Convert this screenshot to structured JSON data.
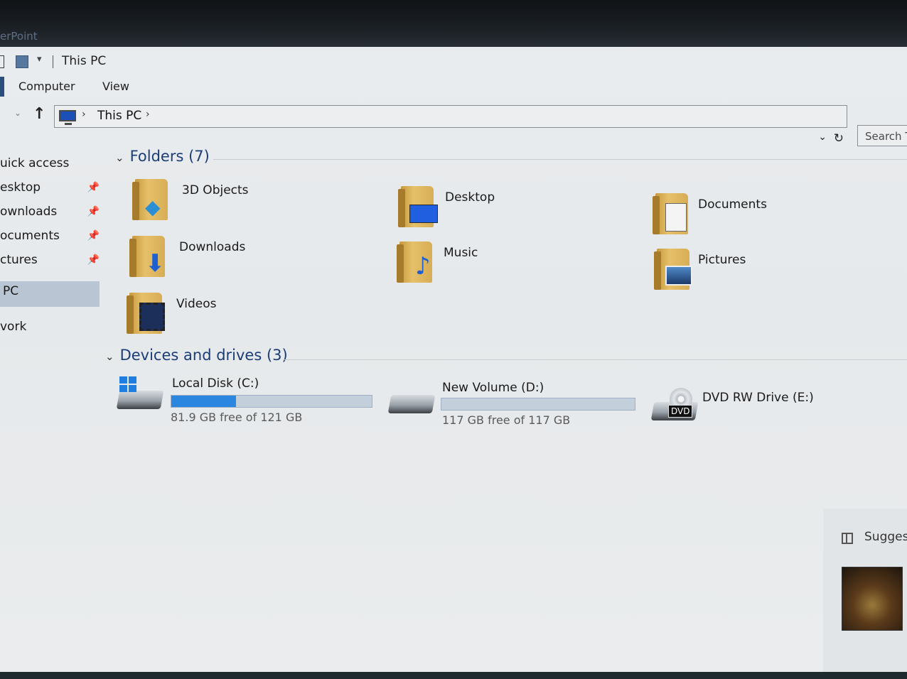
{
  "background_app_label": "erPoint",
  "window": {
    "title": "This PC",
    "qa_dropdown": "▾"
  },
  "ribbon": {
    "tabs": [
      "Computer",
      "View"
    ]
  },
  "address": {
    "path": "This PC",
    "chevron": "›",
    "dropdown": "⌄",
    "refresh": "↻",
    "up": "↑",
    "down": "⌄"
  },
  "search": {
    "placeholder": "Search T"
  },
  "navpane": {
    "items": [
      {
        "label": "uick access",
        "pinned": false
      },
      {
        "label": "esktop",
        "pinned": true
      },
      {
        "label": "ownloads",
        "pinned": true
      },
      {
        "label": "ocuments",
        "pinned": true
      },
      {
        "label": "ctures",
        "pinned": true
      },
      {
        "label": "PC",
        "pinned": false,
        "selected": true
      },
      {
        "label": "vork",
        "pinned": false
      }
    ],
    "pin_glyph": "📌"
  },
  "folders": {
    "header": "Folders (7)",
    "items": [
      {
        "label": "3D Objects",
        "icon": "cube-icon"
      },
      {
        "label": "Desktop",
        "icon": "desktop-icon"
      },
      {
        "label": "Documents",
        "icon": "document-icon"
      },
      {
        "label": "Downloads",
        "icon": "download-arrow-icon"
      },
      {
        "label": "Music",
        "icon": "music-note-icon"
      },
      {
        "label": "Pictures",
        "icon": "picture-icon"
      },
      {
        "label": "Videos",
        "icon": "film-icon"
      }
    ]
  },
  "drives": {
    "header": "Devices and drives (3)",
    "items": [
      {
        "name": "Local Disk (C:)",
        "free": "81.9 GB free of 121 GB",
        "used_fraction": 0.323
      },
      {
        "name": "New Volume (D:)",
        "free": "117 GB free of 117 GB",
        "used_fraction": 0.0
      },
      {
        "name": "DVD RW Drive (E:)",
        "badge": "DVD"
      }
    ]
  },
  "preview": {
    "suggest_label": "Suggest"
  },
  "colors": {
    "drive_bar_fill": "#2b86e0",
    "section_header": "#1b3d78",
    "selected_nav": "#b9c5d2"
  }
}
